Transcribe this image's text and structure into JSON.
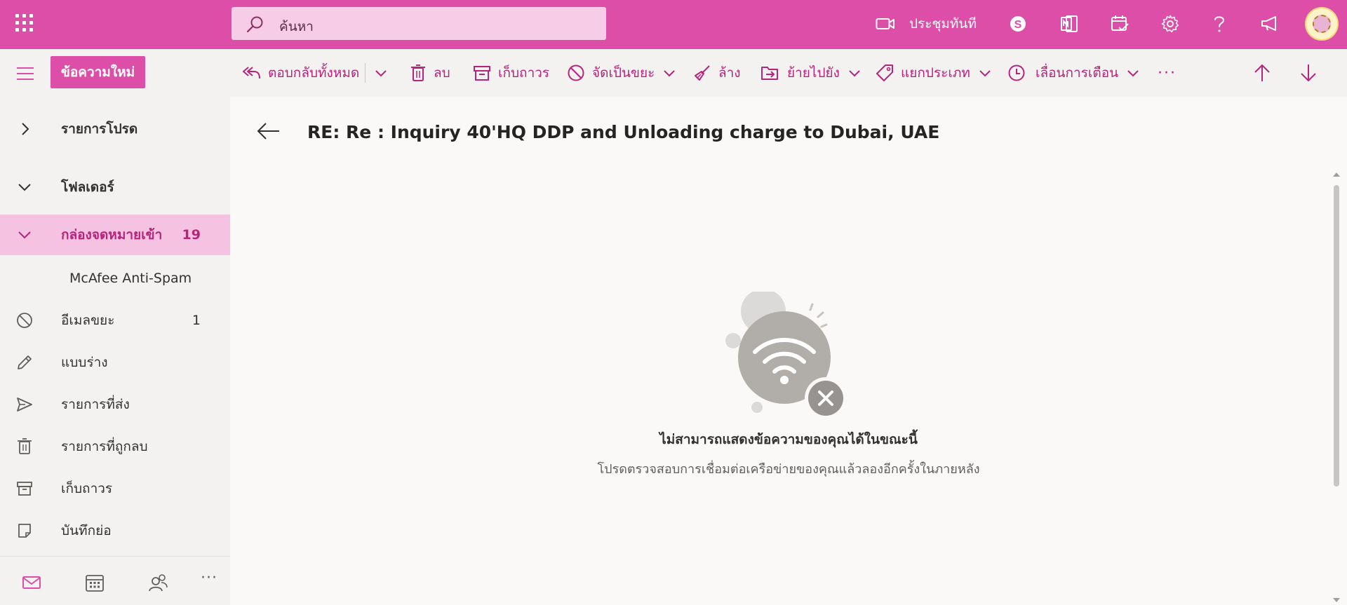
{
  "header": {
    "search_placeholder": "ค้นหา",
    "meet_now_label": "ประชุมทันที",
    "icons": [
      "waffle-icon",
      "video-camera-icon",
      "skype-icon",
      "onenote-icon",
      "calendar-check-icon",
      "gear-icon",
      "help-icon",
      "megaphone-icon"
    ]
  },
  "toolbar": {
    "new_message_label": "ข้อความใหม่",
    "reply_all_label": "ตอบกลับทั้งหมด",
    "delete_label": "ลบ",
    "archive_label": "เก็บถาวร",
    "junk_label": "จัดเป็นขยะ",
    "sweep_label": "ล้าง",
    "move_to_label": "ย้ายไปยัง",
    "categorize_label": "แยกประเภท",
    "snooze_label": "เลื่อนการเตือน",
    "more_label": "···"
  },
  "sidebar": {
    "favorites_label": "รายการโปรด",
    "folders_label": "โฟลเดอร์",
    "inbox": {
      "label": "กล่องจดหมายเข้า",
      "count": "19"
    },
    "items": [
      {
        "label": "McAfee Anti-Spam",
        "count": ""
      },
      {
        "label": "อีเมลขยะ",
        "count": "1"
      },
      {
        "label": "แบบร่าง",
        "count": ""
      },
      {
        "label": "รายการที่ส่ง",
        "count": ""
      },
      {
        "label": "รายการที่ถูกลบ",
        "count": ""
      },
      {
        "label": "เก็บถาวร",
        "count": ""
      },
      {
        "label": "บันทึกย่อ",
        "count": ""
      }
    ],
    "bottom_more_label": "···"
  },
  "reading_pane": {
    "subject": "RE: Re : Inquiry 40'HQ DDP and Unloading charge to Dubai, UAE",
    "error_title": "ไม่สามารถแสดงข้อความของคุณได้ในขณะนี้",
    "error_message": "โปรดตรวจสอบการเชื่อมต่อเครือข่ายของคุณแล้วลองอีกครั้งในภายหลัง"
  },
  "colors": {
    "brand": "#dd4ea8",
    "brand_dark": "#b6247b",
    "selected_bg": "#f6c2e1",
    "search_bg": "#f6cce6"
  }
}
